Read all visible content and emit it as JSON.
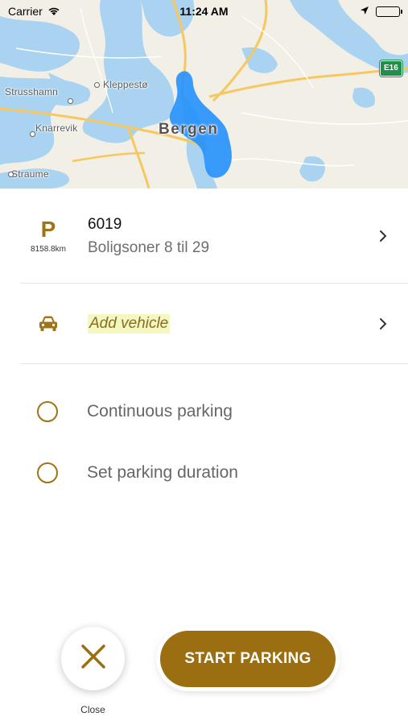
{
  "status_bar": {
    "carrier": "Carrier",
    "time": "11:24 AM",
    "icons": [
      "wifi-icon",
      "location-arrow-icon",
      "battery-icon"
    ]
  },
  "map": {
    "places": {
      "strusshamn": "Strusshamn",
      "kleppesto": "Kleppestø",
      "knarrevik": "Knarrevik",
      "bergen": "Bergen",
      "straume": "Straume"
    },
    "route_shield": "E16",
    "colors": {
      "water": "#a9d3f0",
      "land": "#f1efe6",
      "zone": "#1e90ff",
      "road": "#f7c760"
    }
  },
  "zone": {
    "type_letter": "P",
    "distance": "8158.8km",
    "id": "6019",
    "name": "Boligsoner 8 til 29"
  },
  "vehicle": {
    "placeholder": "Add vehicle",
    "icon": "car-icon"
  },
  "options": [
    {
      "label": "Continuous parking",
      "selected": false
    },
    {
      "label": "Set parking duration",
      "selected": false
    }
  ],
  "actions": {
    "close_label": "Close",
    "start_label": "START PARKING"
  },
  "colors": {
    "accent": "#9b6e12",
    "accent_light": "#a07416",
    "highlight": "#f3f7c0"
  }
}
